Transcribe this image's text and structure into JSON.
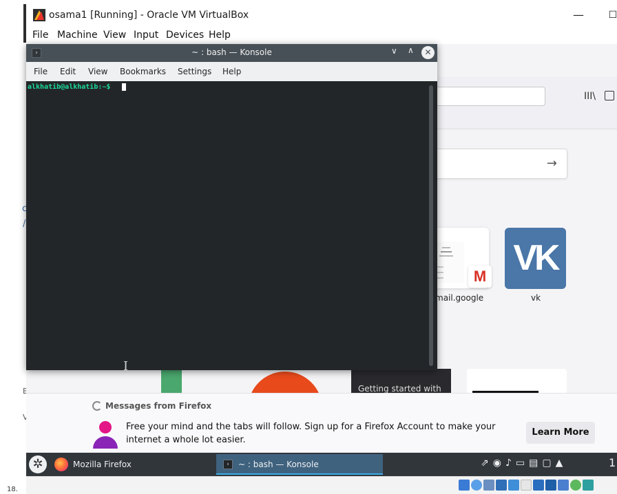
{
  "host_window": {
    "title": "osama1 [Running] - Oracle VM VirtualBox",
    "minimize_glyph": "—",
    "maximize_glyph": "☐",
    "menu": [
      "File",
      "Machine",
      "View",
      "Input",
      "Devices",
      "Help"
    ]
  },
  "konsole": {
    "title": "~ : bash — Konsole",
    "menu": [
      "File",
      "Edit",
      "View",
      "Bookmarks",
      "Settings",
      "Help"
    ],
    "prompt": "alkhatib@alkhatib:~$",
    "controls": {
      "minimize": "∨",
      "maximize": "∧",
      "close": "✕"
    }
  },
  "firefox": {
    "library_icon_glyph": "III\\",
    "search_arrow": "→",
    "top_sites": [
      {
        "label": "mail.google"
      },
      {
        "label": "vk"
      }
    ],
    "gmail_glyph": "M",
    "vk_glyph": "VK",
    "pocket_tile_text": "Getting started with",
    "message": {
      "header": "Messages from Firefox",
      "body": "Free your mind and the tabs will follow. Sign up for a Firefox Account to make your internet a whole lot easier.",
      "button": "Learn More"
    }
  },
  "taskbar": {
    "tasks": [
      {
        "label": "Mozilla Firefox"
      },
      {
        "label": "~ : bash — Konsole"
      }
    ],
    "clock_partial": "1"
  },
  "fragments": {
    "page_number": "18.",
    "c": "c",
    "slash": "/",
    "b": "B",
    "v": "V"
  },
  "colors": {
    "konsole_bg": "#232629",
    "prompt": "#1cdc9a",
    "taskbar": "#31363b",
    "vk": "#4a76a8"
  }
}
